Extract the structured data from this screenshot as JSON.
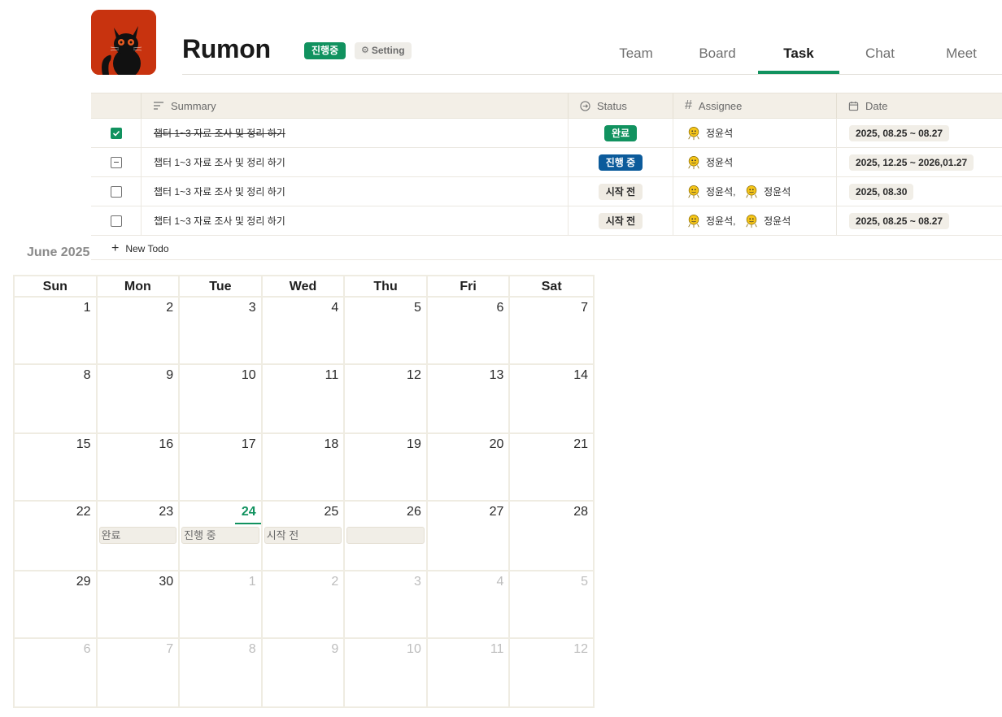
{
  "project": {
    "title": "Rumon",
    "status_badge": "진행중",
    "setting_label": "Setting"
  },
  "tabs": [
    {
      "label": "Team"
    },
    {
      "label": "Board"
    },
    {
      "label": "Task",
      "active": true
    },
    {
      "label": "Chat"
    },
    {
      "label": "Meet"
    }
  ],
  "table": {
    "columns": {
      "summary": "Summary",
      "status": "Status",
      "assignee": "Assignee",
      "date": "Date"
    },
    "rows": [
      {
        "checkbox": "checked",
        "summary": "챕터 1~3 자료 조사 및 정리 하기",
        "status": "완료",
        "status_type": "done",
        "assignees": [
          "정윤석"
        ],
        "date": "2025, 08.25 ~ 08.27"
      },
      {
        "checkbox": "partial",
        "summary": "챕터 1~3 자료 조사 및 정리 하기",
        "status": "진행 중",
        "status_type": "prog",
        "assignees": [
          "정윤석"
        ],
        "date": "2025, 12.25 ~ 2026,01.27"
      },
      {
        "checkbox": "unchecked",
        "summary": "챕터 1~3 자료 조사 및 정리 하기",
        "status": "시작 전",
        "status_type": "todo",
        "assignees": [
          "정윤석",
          "정윤석"
        ],
        "date": "2025, 08.30"
      },
      {
        "checkbox": "unchecked",
        "summary": "챕터 1~3 자료 조사 및 정리 하기",
        "status": "시작 전",
        "status_type": "todo",
        "assignees": [
          "정윤석",
          "정윤석"
        ],
        "date": "2025, 08.25 ~ 08.27"
      }
    ],
    "new_todo_label": "New Todo"
  },
  "calendar": {
    "month_title": "June 2025",
    "weekdays": [
      "Sun",
      "Mon",
      "Tue",
      "Wed",
      "Thu",
      "Fri",
      "Sat"
    ],
    "today": 24,
    "weeks": [
      [
        {
          "n": "1"
        },
        {
          "n": "2"
        },
        {
          "n": "3"
        },
        {
          "n": "4"
        },
        {
          "n": "5"
        },
        {
          "n": "6"
        },
        {
          "n": "7"
        }
      ],
      [
        {
          "n": "8"
        },
        {
          "n": "9"
        },
        {
          "n": "10"
        },
        {
          "n": "11"
        },
        {
          "n": "12"
        },
        {
          "n": "13"
        },
        {
          "n": "14"
        }
      ],
      [
        {
          "n": "15"
        },
        {
          "n": "16"
        },
        {
          "n": "17"
        },
        {
          "n": "18"
        },
        {
          "n": "19"
        },
        {
          "n": "20"
        },
        {
          "n": "21"
        }
      ],
      [
        {
          "n": "22"
        },
        {
          "n": "23",
          "event": "완료"
        },
        {
          "n": "24",
          "today": true,
          "event": "진행 중"
        },
        {
          "n": "25",
          "event": "시작 전"
        },
        {
          "n": "26",
          "event": ""
        },
        {
          "n": "27"
        },
        {
          "n": "28"
        }
      ],
      [
        {
          "n": "29"
        },
        {
          "n": "30"
        },
        {
          "n": "1",
          "other": true
        },
        {
          "n": "2",
          "other": true
        },
        {
          "n": "3",
          "other": true
        },
        {
          "n": "4",
          "other": true
        },
        {
          "n": "5",
          "other": true
        }
      ],
      [
        {
          "n": "6",
          "other": true
        },
        {
          "n": "7",
          "other": true
        },
        {
          "n": "8",
          "other": true
        },
        {
          "n": "9",
          "other": true
        },
        {
          "n": "10",
          "other": true
        },
        {
          "n": "11",
          "other": true
        },
        {
          "n": "12",
          "other": true
        }
      ]
    ]
  },
  "colors": {
    "accent": "#11925f",
    "in_progress": "#0c5b9b",
    "logo_bg": "#c8330f"
  }
}
